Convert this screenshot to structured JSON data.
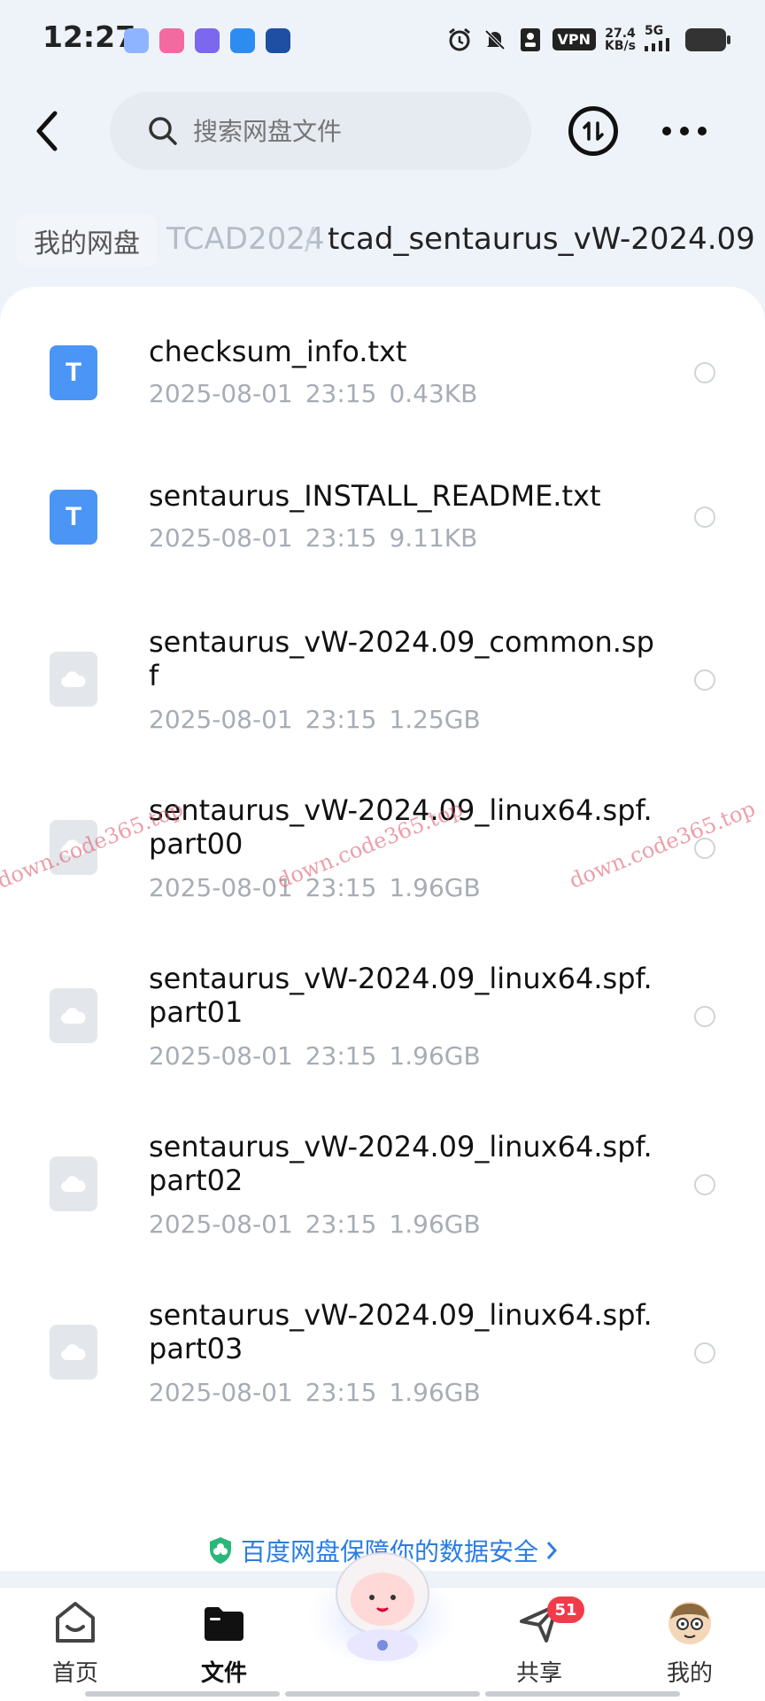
{
  "status_bar": {
    "time": "12:27",
    "vpn": "VPN",
    "speed_value": "27.4",
    "speed_unit": "KB/s",
    "network": "5G"
  },
  "search": {
    "placeholder": "搜索网盘文件"
  },
  "breadcrumb": {
    "home": "我的网盘",
    "middle": "TCAD2024",
    "separator": "/",
    "current": "tcad_sentaurus_vW-2024.09"
  },
  "files": [
    {
      "name": "checksum_info.txt",
      "date": "2025-08-01",
      "time": "23:15",
      "size": "0.43KB",
      "type": "txt",
      "icon_letter": "T"
    },
    {
      "name": "sentaurus_INSTALL_README.txt",
      "date": "2025-08-01",
      "time": "23:15",
      "size": "9.11KB",
      "type": "txt",
      "icon_letter": "T"
    },
    {
      "name": "sentaurus_vW-2024.09_common.spf",
      "date": "2025-08-01",
      "time": "23:15",
      "size": "1.25GB",
      "type": "spf"
    },
    {
      "name": "sentaurus_vW-2024.09_linux64.spf.part00",
      "date": "2025-08-01",
      "time": "23:15",
      "size": "1.96GB",
      "type": "spf"
    },
    {
      "name": "sentaurus_vW-2024.09_linux64.spf.part01",
      "date": "2025-08-01",
      "time": "23:15",
      "size": "1.96GB",
      "type": "spf"
    },
    {
      "name": "sentaurus_vW-2024.09_linux64.spf.part02",
      "date": "2025-08-01",
      "time": "23:15",
      "size": "1.96GB",
      "type": "spf"
    },
    {
      "name": "sentaurus_vW-2024.09_linux64.spf.part03",
      "date": "2025-08-01",
      "time": "23:15",
      "size": "1.96GB",
      "type": "spf"
    }
  ],
  "security_banner": "百度网盘保障你的数据安全",
  "watermark": "down.code365.top",
  "bottom_nav": {
    "home": "首页",
    "files": "文件",
    "share": "共享",
    "share_badge": "51",
    "mine": "我的"
  },
  "colors": {
    "accent": "#2a7de1",
    "txt_icon": "#4a95f5",
    "badge": "#f23b4a"
  },
  "icons": [
    "back-arrow-icon",
    "search-icon",
    "transfer-icon",
    "more-icon",
    "txt-file-icon",
    "cloud-file-icon",
    "shield-icon",
    "home-icon",
    "folder-icon",
    "share-icon",
    "avatar-icon"
  ]
}
